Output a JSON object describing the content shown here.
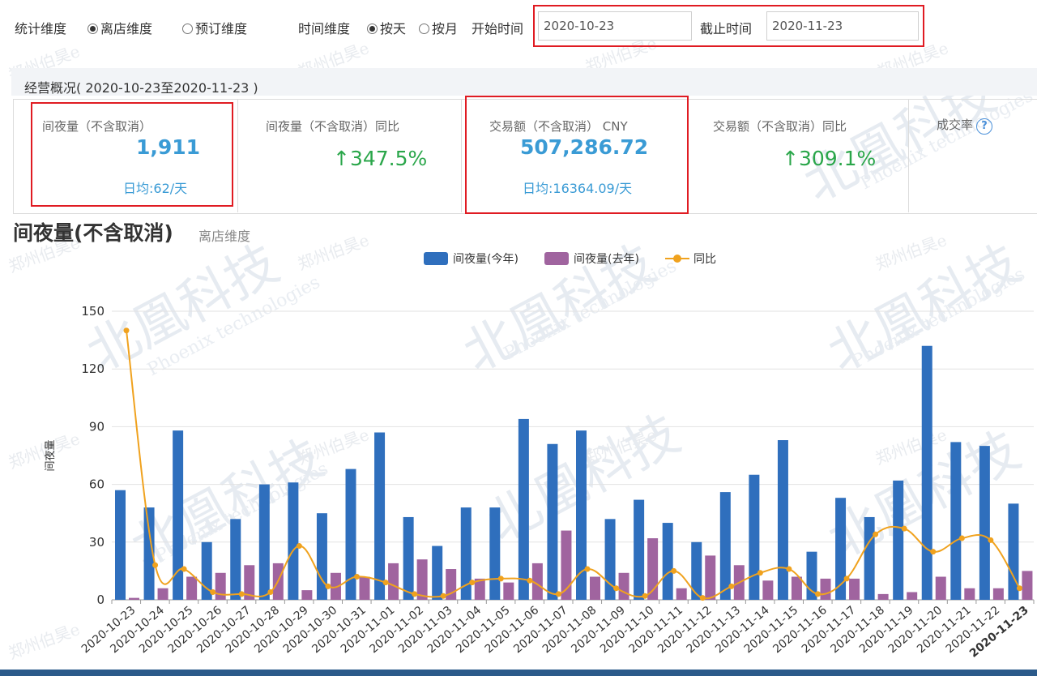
{
  "filters": {
    "stat_dimension_label": "统计维度",
    "stat_options": [
      {
        "label": "离店维度",
        "selected": true
      },
      {
        "label": "预订维度",
        "selected": false
      }
    ],
    "time_dimension_label": "时间维度",
    "time_options": [
      {
        "label": "按天",
        "selected": true
      },
      {
        "label": "按月",
        "selected": false
      }
    ],
    "start_label": "开始时间",
    "start_value": "2020-10-23",
    "end_label": "截止时间",
    "end_value": "2020-11-23"
  },
  "overview": {
    "title": "经营概况( 2020-10-23至2020-11-23 )",
    "kpis": [
      {
        "label": "间夜量（不含取消）",
        "value": "1,911",
        "sub": "日均:62/天"
      },
      {
        "label": "间夜量（不含取消）同比",
        "value": "↑347.5%"
      },
      {
        "label": "交易额（不含取消） CNY",
        "value": "507,286.72",
        "sub": "日均:16364.09/天"
      },
      {
        "label": "交易额（不含取消）同比",
        "value": "↑309.1%"
      },
      {
        "label": "成交率",
        "help": "?"
      }
    ]
  },
  "chart_header": {
    "title": "间夜量(不含取消)",
    "subtitle": "离店维度"
  },
  "colors": {
    "this_year": "#2f6fbd",
    "last_year": "#a0649f",
    "yoy": "#f0a21e",
    "kpi_blue": "#3a9bd5",
    "kpi_green": "#2aa64a",
    "highlight_red": "#e01b22"
  },
  "watermark": {
    "cn_big": "北凰科技",
    "en": "Phoenix technologies",
    "cn_small": "郑州伯昊e"
  },
  "chart_data": {
    "type": "bar",
    "ylabel": "间夜量",
    "ylim": [
      0,
      150
    ],
    "yticks": [
      0,
      30,
      60,
      90,
      120,
      150
    ],
    "grid": true,
    "legend_position": "top-center",
    "categories": [
      "2020-10-23",
      "2020-10-24",
      "2020-10-25",
      "2020-10-26",
      "2020-10-27",
      "2020-10-28",
      "2020-10-29",
      "2020-10-30",
      "2020-10-31",
      "2020-11-01",
      "2020-11-02",
      "2020-11-03",
      "2020-11-04",
      "2020-11-05",
      "2020-11-06",
      "2020-11-07",
      "2020-11-08",
      "2020-11-09",
      "2020-11-10",
      "2020-11-11",
      "2020-11-12",
      "2020-11-13",
      "2020-11-14",
      "2020-11-15",
      "2020-11-16",
      "2020-11-17",
      "2020-11-18",
      "2020-11-19",
      "2020-11-20",
      "2020-11-21",
      "2020-11-22",
      "2020-11-23"
    ],
    "series": [
      {
        "name": "间夜量(今年)",
        "type": "bar",
        "values": [
          57,
          48,
          88,
          30,
          42,
          60,
          61,
          45,
          68,
          87,
          43,
          28,
          48,
          48,
          94,
          81,
          88,
          42,
          52,
          40,
          30,
          56,
          65,
          83,
          25,
          53,
          43,
          62,
          132,
          82,
          80,
          50
        ]
      },
      {
        "name": "间夜量(去年)",
        "type": "bar",
        "values": [
          1,
          6,
          12,
          14,
          18,
          19,
          5,
          14,
          12,
          19,
          21,
          16,
          11,
          9,
          19,
          36,
          12,
          14,
          32,
          6,
          23,
          18,
          10,
          12,
          11,
          11,
          3,
          4,
          12,
          6,
          6,
          15
        ]
      },
      {
        "name": "同比",
        "type": "line",
        "values": [
          140,
          18,
          16,
          4,
          3,
          4,
          28,
          7,
          12,
          9,
          3,
          2,
          9,
          11,
          10,
          3,
          16,
          6,
          2,
          15,
          1,
          7,
          14,
          16,
          3,
          11,
          34,
          37,
          25,
          32,
          31,
          6
        ]
      }
    ]
  }
}
